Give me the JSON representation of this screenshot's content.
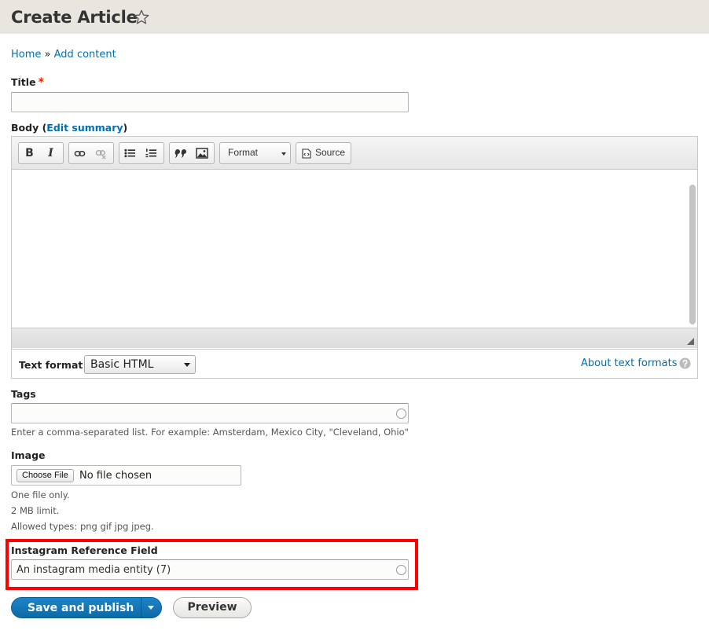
{
  "header": {
    "title": "Create Article",
    "star_icon": "star-outline-icon"
  },
  "breadcrumb": {
    "home": "Home",
    "separator": "»",
    "current": "Add content"
  },
  "title_field": {
    "label": "Title",
    "required_mark": "*",
    "value": ""
  },
  "body_field": {
    "label": "Body",
    "open_paren": "(",
    "edit_summary": "Edit summary",
    "close_paren": ")",
    "toolbar": {
      "bold": "B",
      "italic": "I",
      "format_label": "Format",
      "source_label": "Source"
    },
    "text_format_label": "Text format",
    "text_format_value": "Basic HTML",
    "about_formats": "About text formats"
  },
  "tags": {
    "label": "Tags",
    "value": "",
    "description": "Enter a comma-separated list. For example: Amsterdam, Mexico City, \"Cleveland, Ohio\""
  },
  "image": {
    "label": "Image",
    "choose_file": "Choose File",
    "no_file": "No file chosen",
    "help": [
      "One file only.",
      "2 MB limit.",
      "Allowed types: png gif jpg jpeg."
    ]
  },
  "instagram": {
    "label": "Instagram Reference Field",
    "value": "An instagram media entity (7)"
  },
  "actions": {
    "save": "Save and publish",
    "preview": "Preview"
  },
  "colors": {
    "link": "#0071b3",
    "primary": "#0d6aa6",
    "highlight": "#ff0000",
    "required": "#e32700"
  }
}
